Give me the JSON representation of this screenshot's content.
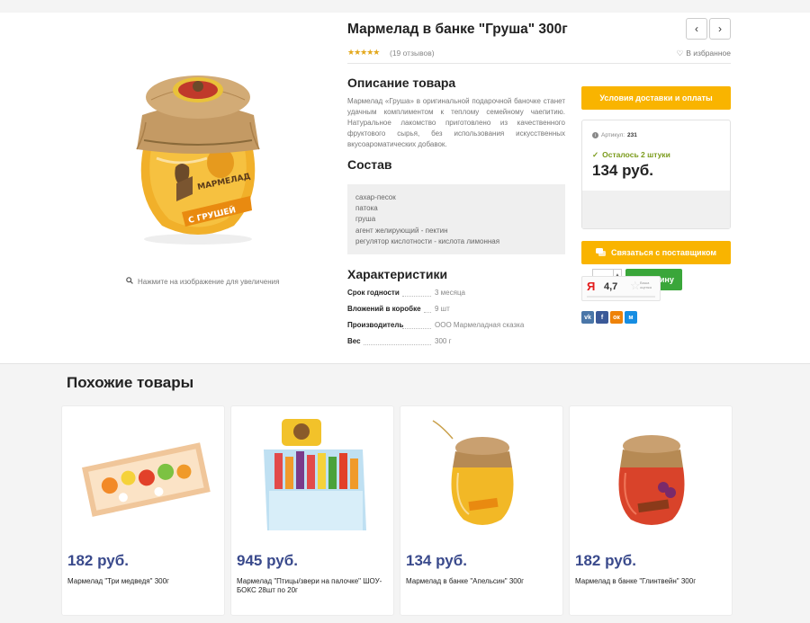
{
  "product": {
    "title": "Мармелад в банке \"Груша\" 300г",
    "rating_stars": "★★★★★",
    "reviews": "(19 отзывов)",
    "favorite": "В избранное",
    "zoom_hint": "Нажмите на изображение для увеличения",
    "jar_label": "МАРМЕЛАД",
    "jar_flavor": "С ГРУШЕЙ"
  },
  "description": {
    "heading": "Описание товара",
    "text": "Мармелад «Груша» в оригинальной подарочной баночке станет удачным комплиментом к теплому семейному чаепитию. Натуральное лакомство приготовлено из качественного фруктового сырья, без использования искусственных вкусоароматических добавок."
  },
  "composition": {
    "heading": "Состав",
    "items": [
      "сахар-песок",
      "патока",
      "груша",
      "агент желирующий - пектин",
      "регулятор кислотности - кислота лимонная"
    ]
  },
  "characteristics": {
    "heading": "Характеристики",
    "rows": [
      {
        "label": "Срок годности",
        "value": "3 месяца"
      },
      {
        "label": "Вложений в коробке",
        "value": "9 шт"
      },
      {
        "label": "Производитель",
        "value": "ООО Мармеладная сказка"
      },
      {
        "label": "Вес",
        "value": "300 г"
      }
    ]
  },
  "buy": {
    "delivery_button": "Условия доставки и оплаты",
    "article_label": "Артикул:",
    "article_value": "231",
    "stock": "Осталось 2 штуки",
    "price": "134 руб.",
    "qty": "1",
    "cart_button": "В корзину",
    "contact_button": "Связаться с поставщиком"
  },
  "yandex": {
    "logo": "Я",
    "score": "4,7",
    "star": "☆",
    "small_text": "Ваша оценка"
  },
  "socials": [
    {
      "label": "vk",
      "color": "#4a76a8"
    },
    {
      "label": "f",
      "color": "#3b5998"
    },
    {
      "label": "ок",
      "color": "#ee8208"
    },
    {
      "label": "м",
      "color": "#168de2"
    }
  ],
  "similar": {
    "heading": "Похожие товары",
    "items": [
      {
        "price": "182 руб.",
        "name": "Мармелад \"Три медведя\" 300г"
      },
      {
        "price": "945 руб.",
        "name": "Мармелад \"Птицы/звери на палочке\" ШОУ-БОКС 28шт по 20г"
      },
      {
        "price": "134 руб.",
        "name": "Мармелад в банке \"Апельсин\" 300г"
      },
      {
        "price": "182 руб.",
        "name": "Мармелад в банке \"Глинтвейн\" 300г"
      }
    ]
  },
  "colors": {
    "accent_yellow": "#f9b400",
    "cart_green": "#3aa63a",
    "price_blue": "#3a4a8c"
  }
}
